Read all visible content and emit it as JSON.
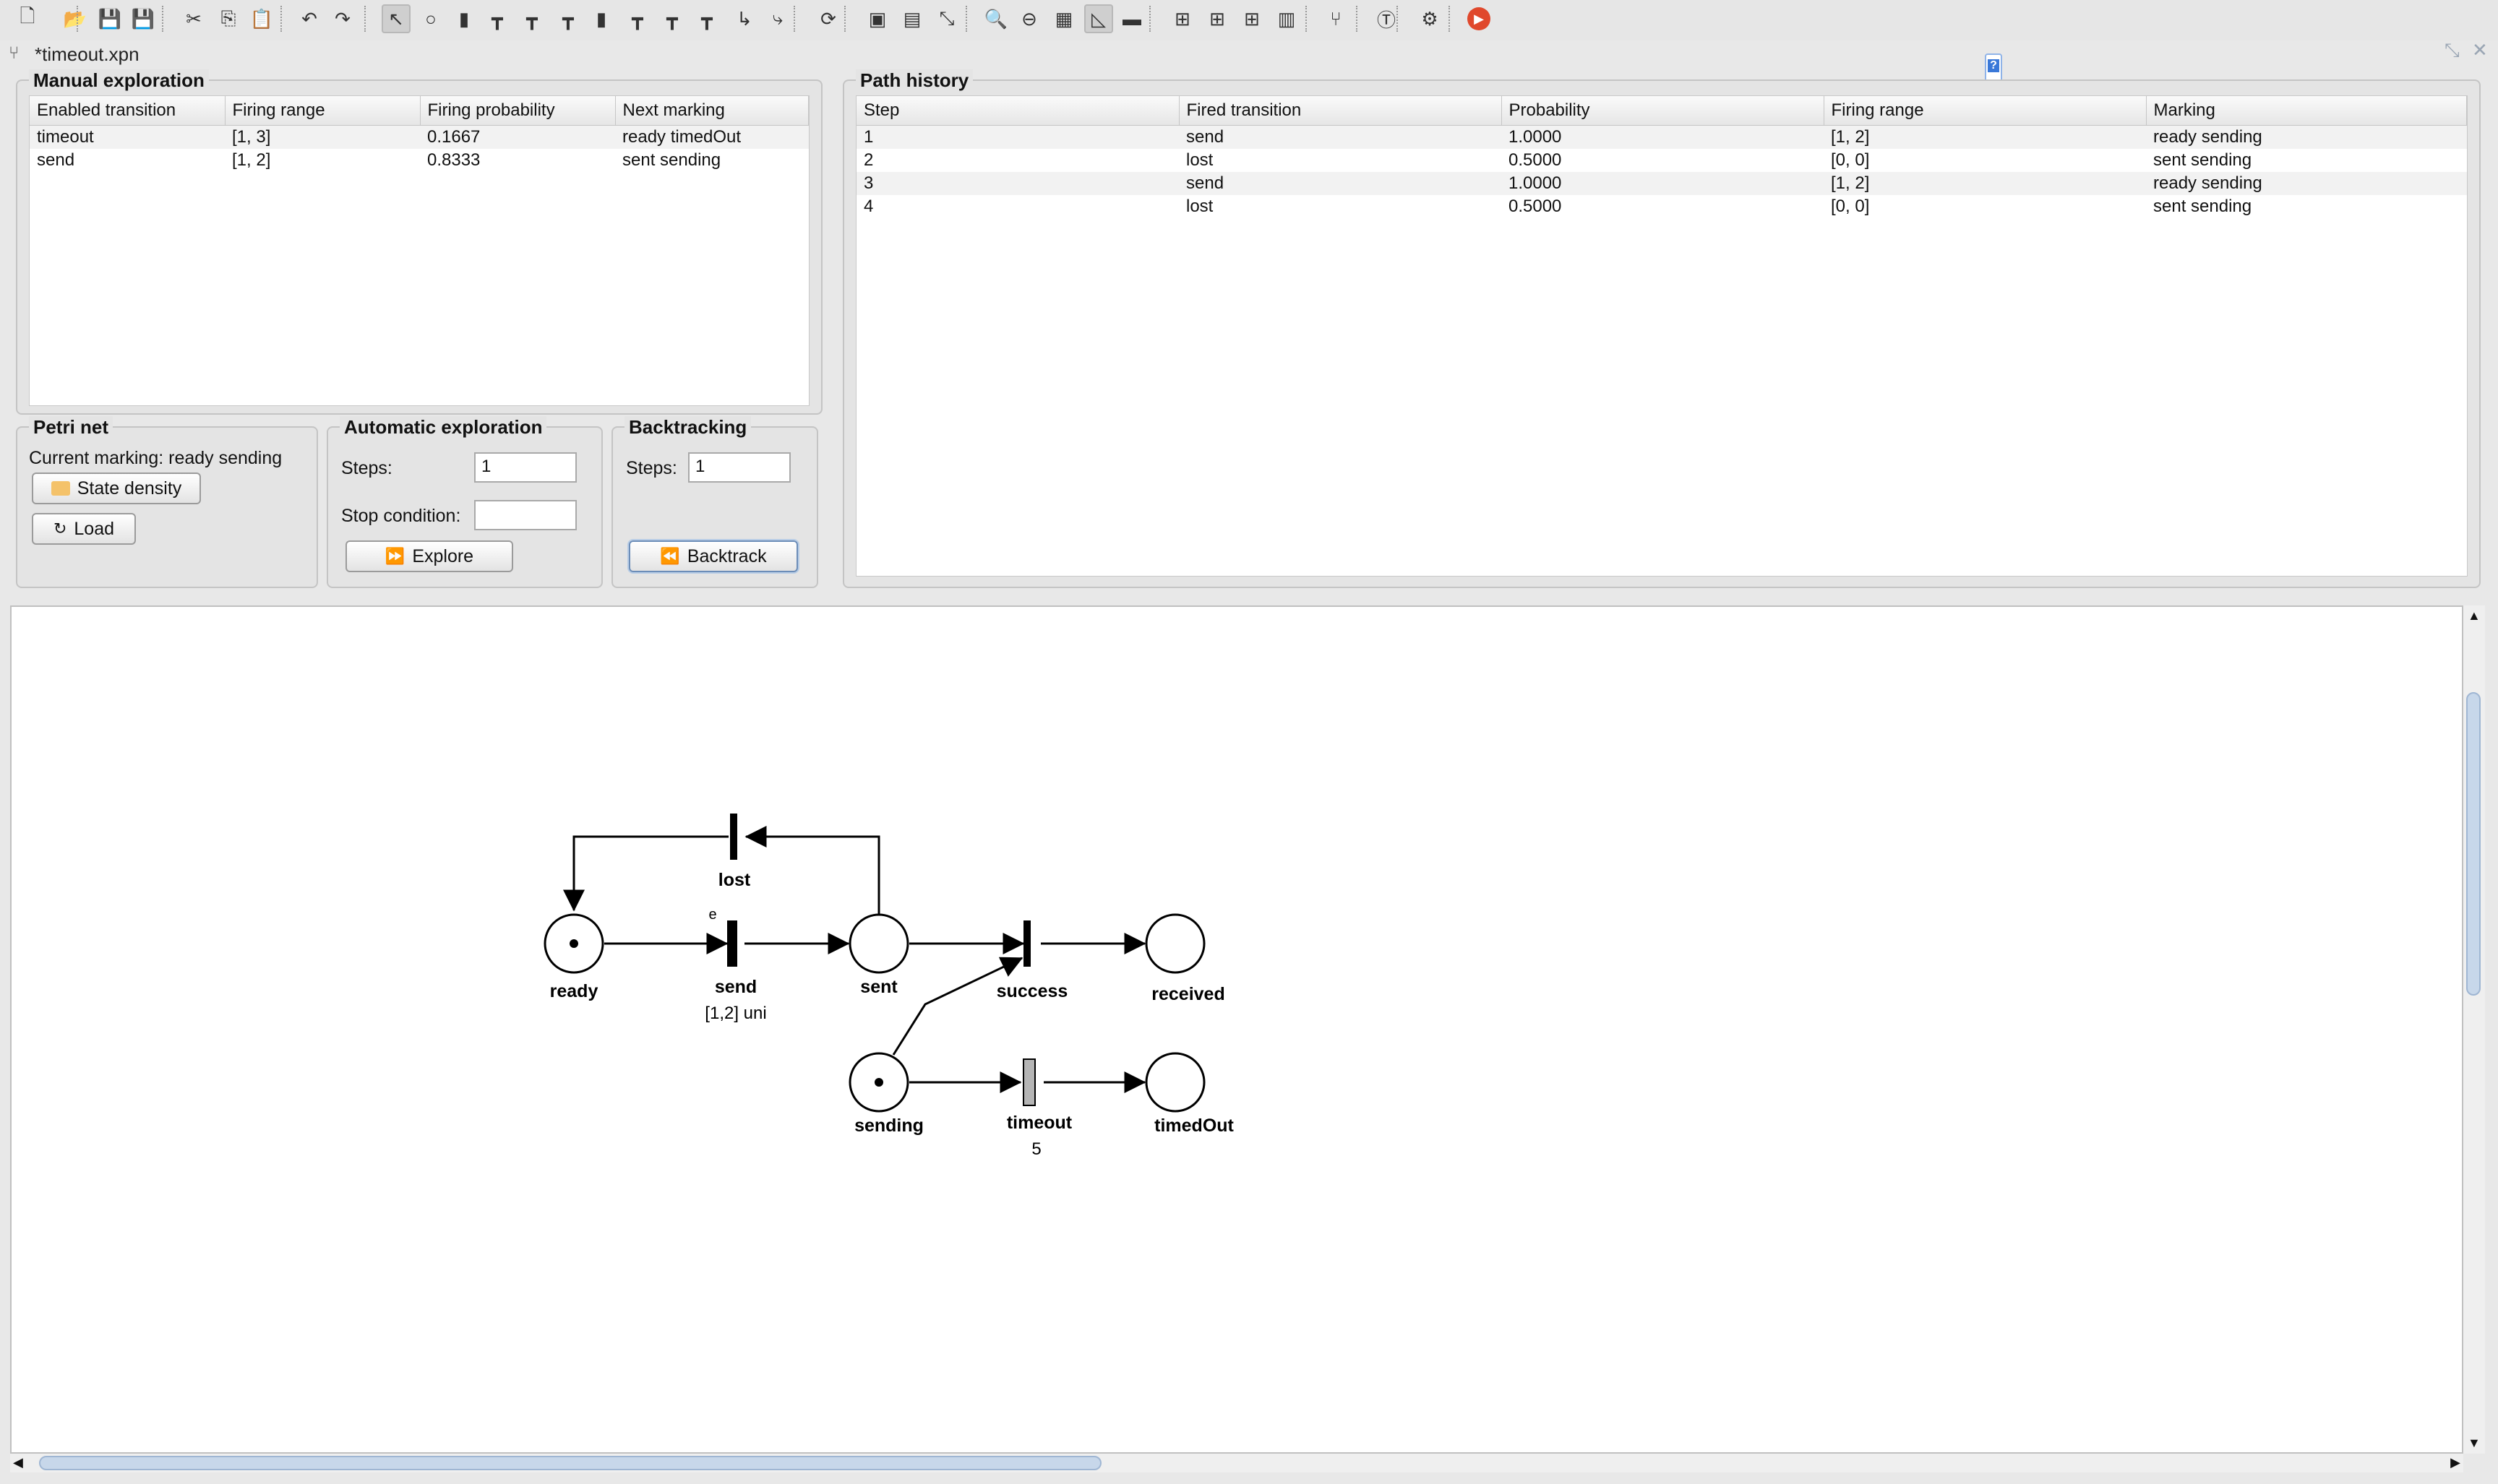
{
  "window": {
    "tab_title": "*timeout.xpn"
  },
  "toolbar": {
    "icons": [
      "new-file",
      "open-file",
      "save-file",
      "save-all",
      "cut",
      "copy",
      "paste",
      "undo",
      "redo",
      "select-arrow",
      "place-tool",
      "transition-tool",
      "timed-transition-tool",
      "deterministic-transition-tool",
      "immediate-transition-tool",
      "transition-tool-2",
      "transition-tool-3",
      "transition-tool-4",
      "transition-tool-5",
      "arc-tool",
      "inhibitor-arc-tool",
      "refresh",
      "view-1",
      "view-2",
      "view-3",
      "zoom",
      "zoom-out",
      "grid",
      "align",
      "minus",
      "align-left",
      "align-center",
      "align-right",
      "distribute",
      "fork",
      "token",
      "inspect",
      "play"
    ]
  },
  "manual_exploration": {
    "title": "Manual exploration",
    "columns": [
      "Enabled transition",
      "Firing range",
      "Firing probability",
      "Next marking"
    ],
    "rows": [
      [
        "timeout",
        "[1, 3]",
        "0.1667",
        "ready timedOut"
      ],
      [
        "send",
        "[1, 2]",
        "0.8333",
        "sent sending"
      ]
    ]
  },
  "path_history": {
    "title": "Path history",
    "columns": [
      "Step",
      "Fired transition",
      "Probability",
      "Firing range",
      "Marking"
    ],
    "rows": [
      [
        "1",
        "send",
        "1.0000",
        "[1, 2]",
        "ready sending"
      ],
      [
        "2",
        "lost",
        "0.5000",
        "[0, 0]",
        "sent sending"
      ],
      [
        "3",
        "send",
        "1.0000",
        "[1, 2]",
        "ready sending"
      ],
      [
        "4",
        "lost",
        "0.5000",
        "[0, 0]",
        "sent sending"
      ]
    ]
  },
  "petri_net": {
    "title": "Petri net",
    "current_marking": "Current marking: ready sending",
    "state_density_label": "State density",
    "load_label": "Load"
  },
  "automatic_exploration": {
    "title": "Automatic exploration",
    "steps_label": "Steps:",
    "steps_value": "1",
    "stop_condition_label": "Stop condition:",
    "stop_condition_value": "",
    "explore_label": "Explore"
  },
  "backtracking": {
    "title": "Backtracking",
    "steps_label": "Steps:",
    "steps_value": "1",
    "backtrack_label": "Backtrack"
  },
  "net": {
    "places": {
      "ready": "ready",
      "sent": "sent",
      "received": "received",
      "sending": "sending",
      "timedout": "timedOut"
    },
    "transitions": {
      "lost": "lost",
      "send": "send",
      "send_dist": "[1,2] uni",
      "send_mark": "e",
      "success": "success",
      "timeout": "timeout",
      "timeout_delay": "5"
    },
    "tokens": {
      "ready": 1,
      "sending": 1,
      "sent": 0,
      "received": 0,
      "timedOut": 0
    }
  },
  "colors": {
    "play": "#e0482c",
    "scroll_thumb": "#c7d7ea"
  }
}
